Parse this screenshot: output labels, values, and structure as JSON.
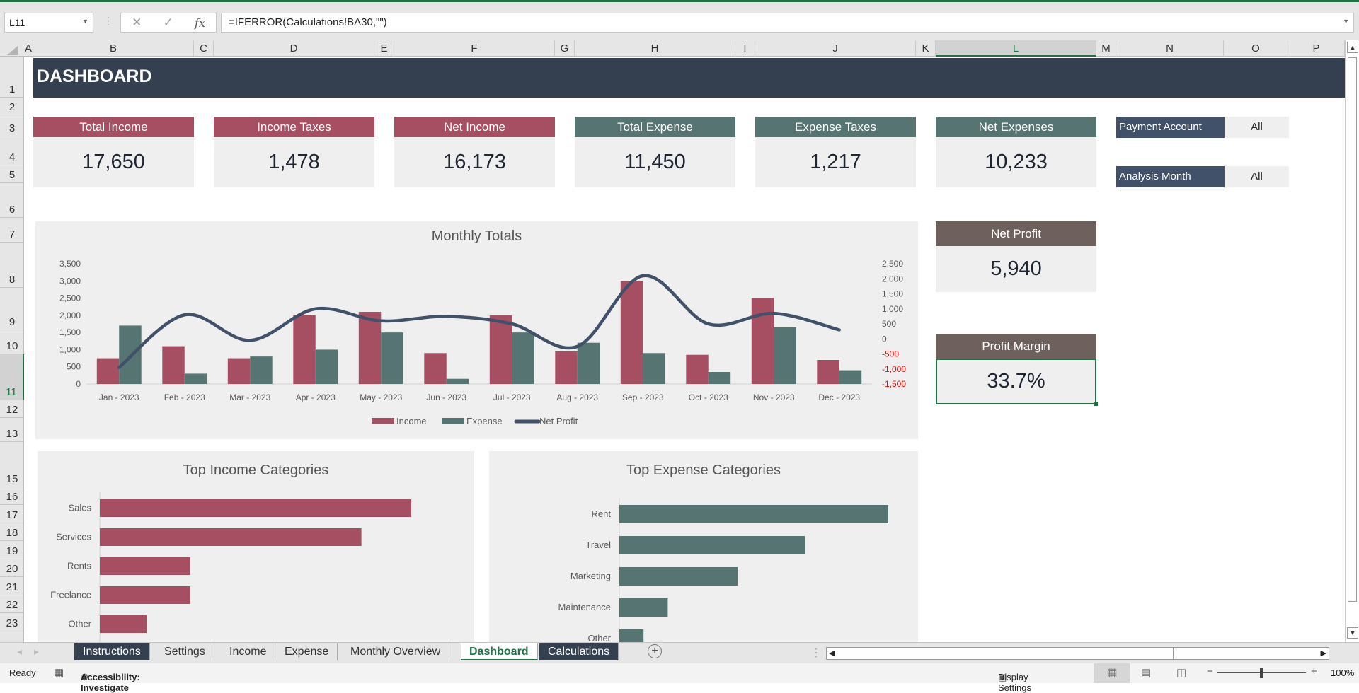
{
  "formula_bar": {
    "name_box": "L11",
    "formula": "=IFERROR(Calculations!BA30,\"\")"
  },
  "columns": [
    "A",
    "B",
    "C",
    "D",
    "E",
    "F",
    "G",
    "H",
    "I",
    "J",
    "K",
    "L",
    "M",
    "N",
    "O",
    "P"
  ],
  "rows": [
    "1",
    "2",
    "3",
    "4",
    "5",
    "6",
    "7",
    "8",
    "9",
    "10",
    "11",
    "12",
    "13",
    "15",
    "16",
    "17",
    "18",
    "19",
    "20",
    "21",
    "22",
    "23"
  ],
  "banner": "DASHBOARD",
  "kpis": [
    {
      "label": "Total Income",
      "value": "17,650"
    },
    {
      "label": "Income Taxes",
      "value": "1,478"
    },
    {
      "label": "Net Income",
      "value": "16,173"
    },
    {
      "label": "Total Expense",
      "value": "11,450"
    },
    {
      "label": "Expense Taxes",
      "value": "1,217"
    },
    {
      "label": "Net Expenses",
      "value": "10,233"
    }
  ],
  "filters": [
    {
      "label": "Payment Account",
      "value": "All"
    },
    {
      "label": "Analysis Month",
      "value": "All"
    }
  ],
  "net_profit": {
    "label": "Net Profit",
    "value": "5,940"
  },
  "profit_margin": {
    "label": "Profit Margin",
    "value": "33.7%"
  },
  "colors": {
    "income": "#a64f63",
    "expense": "#557472",
    "net_profit": "#415169",
    "banner": "#344050",
    "negative": "#ff0000"
  },
  "chart_data": [
    {
      "type": "bar",
      "title": "Monthly Totals",
      "categories": [
        "Jan - 2023",
        "Feb - 2023",
        "Mar - 2023",
        "Apr - 2023",
        "May - 2023",
        "Jun - 2023",
        "Jul - 2023",
        "Aug - 2023",
        "Sep - 2023",
        "Oct - 2023",
        "Nov - 2023",
        "Dec - 2023"
      ],
      "series": [
        {
          "name": "Income",
          "type": "bar",
          "axis": "primary",
          "values": [
            750,
            1100,
            750,
            2000,
            2100,
            900,
            2000,
            950,
            3000,
            850,
            2500,
            700
          ]
        },
        {
          "name": "Expense",
          "type": "bar",
          "axis": "primary",
          "values": [
            1700,
            300,
            800,
            1000,
            1500,
            150,
            1500,
            1200,
            900,
            350,
            1650,
            400
          ]
        },
        {
          "name": "Net Profit",
          "type": "line",
          "smooth": true,
          "axis": "secondary",
          "values": [
            -950,
            800,
            -50,
            1000,
            600,
            750,
            500,
            -250,
            2100,
            500,
            850,
            300
          ]
        }
      ],
      "ylim": [
        0,
        3500
      ],
      "yticks": [
        "0",
        "500",
        "1,000",
        "1,500",
        "2,000",
        "2,500",
        "3,000",
        "3,500"
      ],
      "y2lim": [
        -1500,
        2500
      ],
      "y2ticks": [
        "-1,500",
        "-1,000",
        "-500",
        "0",
        "500",
        "1,000",
        "1,500",
        "2,000",
        "2,500"
      ],
      "legend": "bottom"
    },
    {
      "type": "bar",
      "orientation": "horizontal",
      "title": "Top Income Categories",
      "categories": [
        "Sales",
        "Services",
        "Rents",
        "Freelance",
        "Other"
      ],
      "values": [
        100,
        84,
        29,
        29,
        15
      ]
    },
    {
      "type": "bar",
      "orientation": "horizontal",
      "title": "Top Expense Categories",
      "categories": [
        "Rent",
        "Travel",
        "Marketing",
        "Maintenance",
        "Other"
      ],
      "values": [
        100,
        69,
        44,
        18,
        9
      ]
    }
  ],
  "sheet_tabs": [
    {
      "label": "Instructions",
      "style": "dark"
    },
    {
      "label": "Settings",
      "style": "plain"
    },
    {
      "label": "Income",
      "style": "plain"
    },
    {
      "label": "Expense",
      "style": "plain"
    },
    {
      "label": "Monthly Overview",
      "style": "plain"
    },
    {
      "label": "Dashboard",
      "style": "active"
    },
    {
      "label": "Calculations",
      "style": "dark"
    }
  ],
  "status": {
    "ready": "Ready",
    "accessibility": "Accessibility: Investigate",
    "display_settings": "Display Settings",
    "zoom": "100%"
  }
}
